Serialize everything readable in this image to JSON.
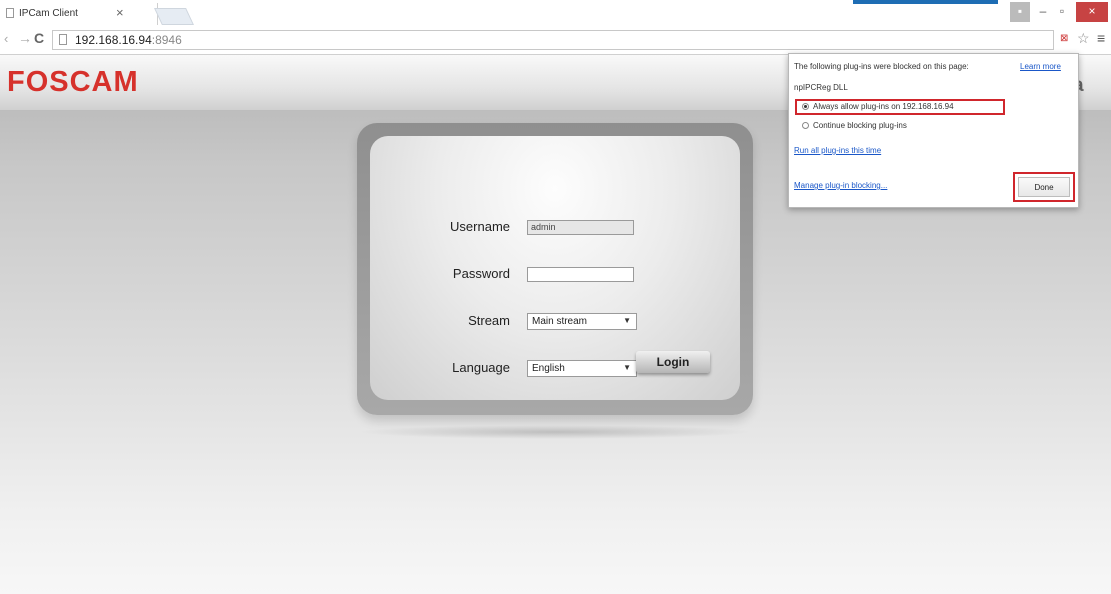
{
  "browser": {
    "tab_title": "IPCam Client",
    "tab_close": "×",
    "url_host": "192.168.16.94",
    "url_port": ":8946",
    "window_controls": {
      "minimize": "–",
      "maximize": "▫",
      "close": "×"
    }
  },
  "page": {
    "logo": "FOSCAM",
    "header_right_fragment": "a",
    "form": {
      "username_label": "Username",
      "username_value": "admin",
      "password_label": "Password",
      "password_value": "",
      "stream_label": "Stream",
      "stream_value": "Main stream",
      "language_label": "Language",
      "language_value": "English",
      "login_label": "Login"
    }
  },
  "plugin_popup": {
    "message": "The following plug-ins were blocked on this page:",
    "learn_more": "Learn more",
    "plugin_name": "npIPCReg DLL",
    "option_allow": "Always allow plug-ins on 192.168.16.94",
    "option_block": "Continue blocking plug-ins",
    "run_all": "Run all plug-ins this time",
    "manage": "Manage plug-in blocking...",
    "done": "Done",
    "selected_option": "allow"
  },
  "colors": {
    "brand_red": "#d6312b",
    "link_blue": "#1a57c8",
    "highlight_red": "#d0262c",
    "window_accent": "#1e6db4"
  }
}
